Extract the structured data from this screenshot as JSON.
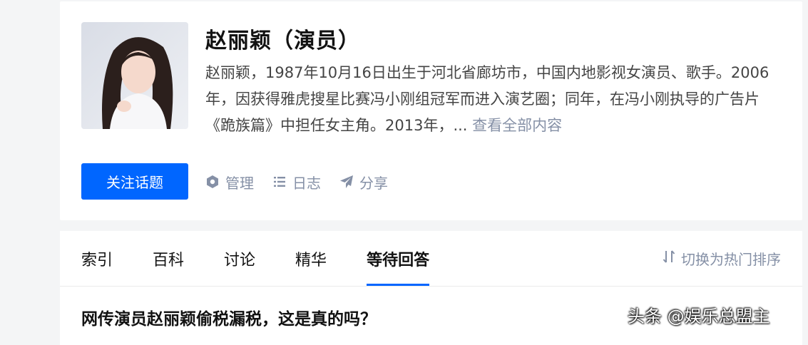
{
  "topic": {
    "title": "赵丽颖（演员）",
    "description": "赵丽颖，1987年10月16日出生于河北省廊坊市，中国内地影视女演员、歌手。2006年，因获得雅虎搜星比赛冯小刚组冠军而进入演艺圈；同年，在冯小刚执导的广告片《跪族篇》中担任女主角。2013年，... ",
    "read_more": "查看全部内容",
    "follow_label": "关注话题",
    "actions": {
      "manage": "管理",
      "log": "日志",
      "share": "分享"
    }
  },
  "tabs": [
    {
      "label": "索引",
      "active": false
    },
    {
      "label": "百科",
      "active": false
    },
    {
      "label": "讨论",
      "active": false
    },
    {
      "label": "精华",
      "active": false
    },
    {
      "label": "等待回答",
      "active": true
    }
  ],
  "sort_toggle": "切换为热门排序",
  "question": {
    "title": "网传演员赵丽颖偷税漏税，这是真的吗？"
  },
  "watermark": "头条 @娱乐总盟主",
  "colors": {
    "accent": "#0066ff",
    "muted": "#8590a6"
  }
}
